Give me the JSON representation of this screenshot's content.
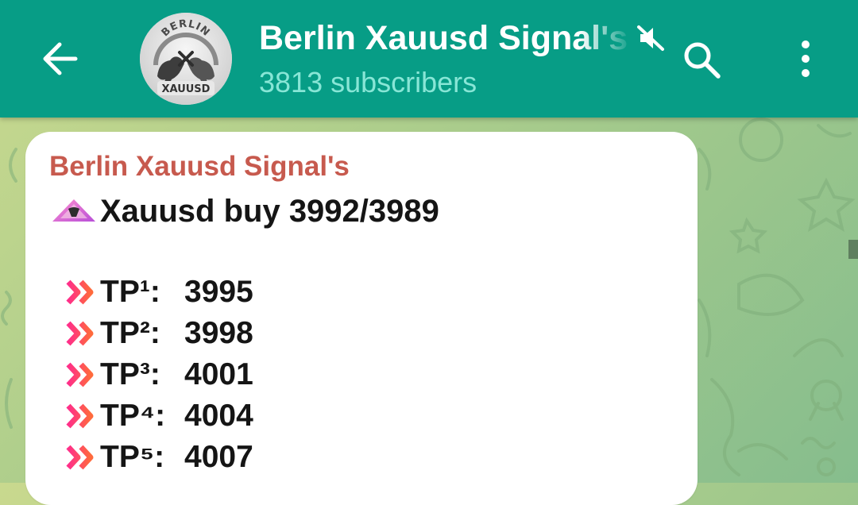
{
  "header": {
    "back_icon": "arrow-left-icon",
    "channel_title": "Berlin Xauusd Signal's",
    "subscribers": "3813 subscribers",
    "mute_icon": "muted-speaker-icon",
    "search_icon": "search-icon",
    "more_icon": "more-vertical-icon",
    "background_color": "#079d86",
    "avatar": {
      "top_text": "BERLIN",
      "bottom_text": "XAUUSD"
    }
  },
  "message": {
    "sender": "Berlin Xauusd Signal's",
    "sender_color": "#c75a4e",
    "signal_icon": "pink-triangle-emoji",
    "signal_text": "Xauusd buy 3992/3989",
    "targets": [
      {
        "label": "TP¹:",
        "value": "3995",
        "icon": "double-chevron-right-icon"
      },
      {
        "label": "TP²:",
        "value": "3998",
        "icon": "double-chevron-right-icon"
      },
      {
        "label": "TP³:",
        "value": "4001",
        "icon": "double-chevron-right-icon"
      },
      {
        "label": "TP⁴:",
        "value": "4004",
        "icon": "double-chevron-right-icon"
      },
      {
        "label": "TP⁵:",
        "value": "4007",
        "icon": "double-chevron-right-icon"
      }
    ]
  }
}
